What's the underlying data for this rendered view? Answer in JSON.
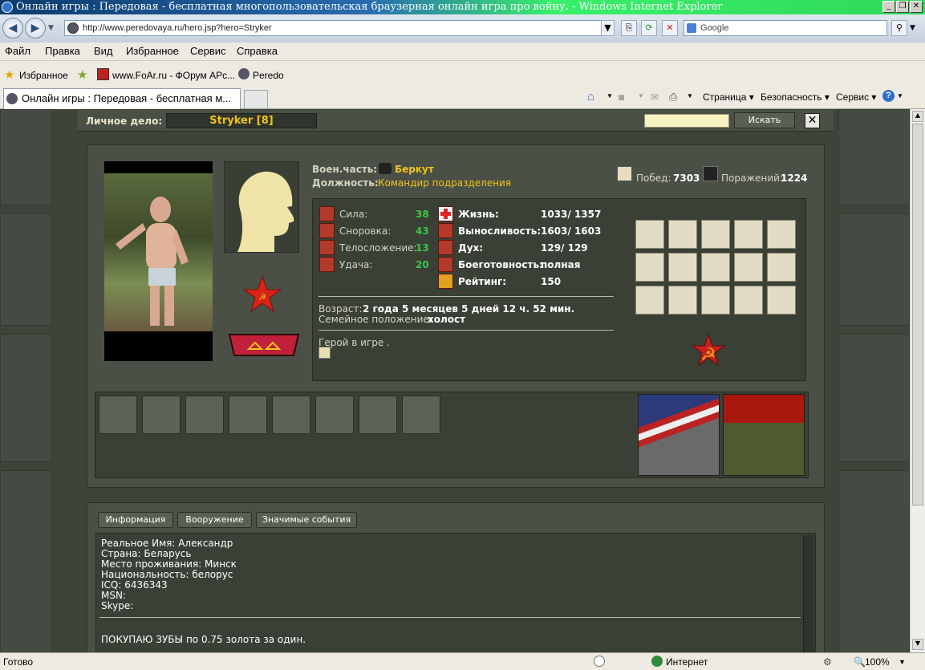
{
  "window": {
    "title": "Онлайн игры : Передовая - бесплатная многопользовательская браузерная онлайн игра про войну. - Windows Internet Explorer"
  },
  "nav": {
    "url": "http://www.peredovaya.ru/hero.jsp?hero=Stryker",
    "search_placeholder": "Google"
  },
  "menu": {
    "items": [
      "Файл",
      "Правка",
      "Вид",
      "Избранное",
      "Сервис",
      "Справка"
    ]
  },
  "favorites": {
    "label": "Избранное",
    "links": [
      "www.FoAr.ru - ФОрум АРс...",
      "Peredo"
    ]
  },
  "tabs": {
    "active": "Онлайн игры : Передовая - бесплатная м..."
  },
  "commandbar": {
    "page": "Страница",
    "security": "Безопасность",
    "tools": "Сервис"
  },
  "status": {
    "ready": "Готово",
    "zone": "Интернет",
    "zoom": "100%"
  },
  "header": {
    "case_label": "Личное дело:",
    "player_name": "Stryker [8]",
    "search_button": "Искать"
  },
  "profile": {
    "unit_label": "Воен.часть:",
    "unit_value": "Беркут",
    "position_label": "Должность:",
    "position_value": "Командир подразделения",
    "wins_label": "Побед:",
    "wins_value": "7303",
    "losses_label": "Поражений:",
    "losses_value": "1224",
    "stats": [
      {
        "label": "Сила:",
        "value": "38"
      },
      {
        "label": "Сноровка:",
        "value": "43"
      },
      {
        "label": "Телосложение:",
        "value": "13"
      },
      {
        "label": "Удача:",
        "value": "20"
      }
    ],
    "vitals": [
      {
        "label": "Жизнь:",
        "value": "1033/ 1357"
      },
      {
        "label": "Выносливость:",
        "value": "1603/ 1603"
      },
      {
        "label": "Дух:",
        "value": "129/ 129"
      },
      {
        "label": "Боеготовность:",
        "value": "полная"
      },
      {
        "label": "Рейтинг:",
        "value": "150"
      }
    ],
    "age_label": "Возраст:",
    "age_value": "2 года 5 месяцев 5 дней 12 ч. 52 мин.",
    "family_label": "Семейное положение:",
    "family_value": "холост",
    "hero_text": "Герой в игре ."
  },
  "lower": {
    "tabs": [
      "Информация",
      "Вооружение",
      "Значимые события"
    ],
    "lines": [
      "Реальное Имя: Александр",
      "Страна: Беларусь",
      "Место проживания: Минск",
      "Национальность: белорус",
      "ICQ: 6436343",
      "MSN:",
      "Skype:"
    ],
    "note": "ПОКУПАЮ ЗУБЫ по 0.75 золота за один."
  },
  "colors": {
    "accent_yellow": "#f3c31c",
    "stat_green": "#3cc54a",
    "panel_dark": "#3a4035"
  }
}
